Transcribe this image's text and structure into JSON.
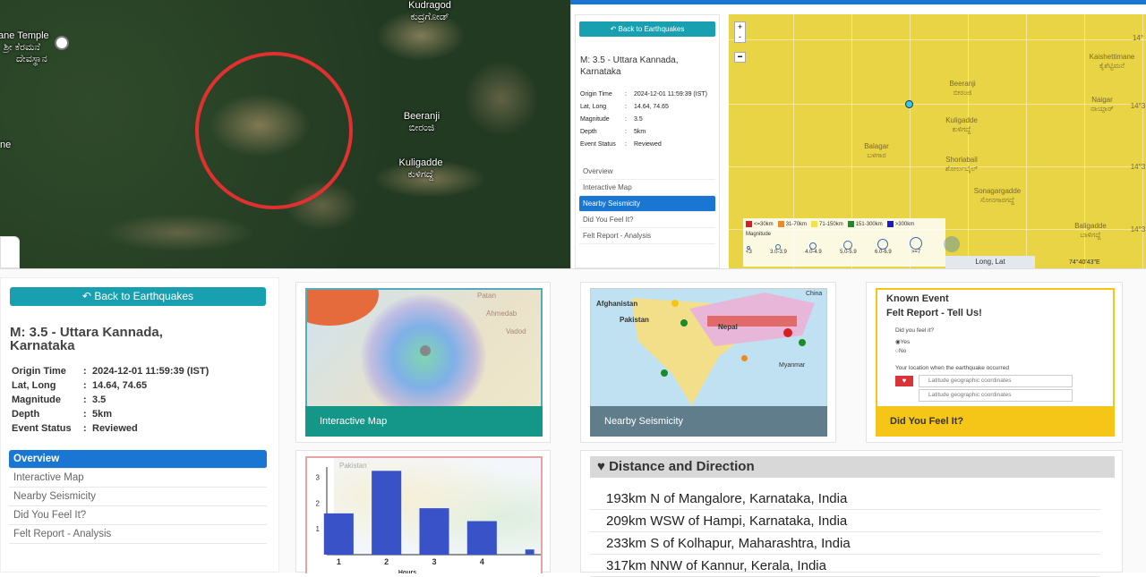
{
  "satellite": {
    "labels": [
      "Kudragod",
      "ಕುದ್ರಗೋಡ್",
      "ane Temple",
      "ಶ್ರೀ ಕೆರಮನೆ",
      "ದೇವಸ್ಥಾನ",
      "Beeranji",
      "ಬೀರಂಜಿ",
      "Kuligadde",
      "ಕುಳಿಗದ್ದೆ",
      "ne"
    ]
  },
  "small_panel": {
    "back_label": "Back to Earthquakes",
    "title": "M: 3.5 - Uttara Kannada, Karnataka",
    "info": [
      {
        "k": "Origin Time",
        "v": "2024-12-01 11:59:39 (IST)"
      },
      {
        "k": "Lat, Long",
        "v": "14.64, 74.65"
      },
      {
        "k": "Magnitude",
        "v": "3.5"
      },
      {
        "k": "Depth",
        "v": "5km"
      },
      {
        "k": "Event Status",
        "v": "Reviewed"
      }
    ],
    "nav": [
      "Overview",
      "Interactive Map",
      "Nearby Seismicity",
      "Did You Feel It?",
      "Felt Report - Analysis"
    ],
    "active_nav": 2
  },
  "yellow_map": {
    "zoom_in": "+",
    "zoom_out": "-",
    "towns": [
      {
        "en": "Beeranji",
        "kn": "ಬೀರಂಜಿ"
      },
      {
        "en": "Kuligadde",
        "kn": "ಕುಳಿಗದ್ದೆ"
      },
      {
        "en": "Shorlabail",
        "kn": "ಶೋರ್ಲಬೈಲ್"
      },
      {
        "en": "Balagar",
        "kn": "ಬಳಗಾರ"
      },
      {
        "en": "Sonagargadde",
        "kn": "ಸೋನಗಾರಗದ್ದೆ"
      },
      {
        "en": "Kaishettimane",
        "kn": "ಕೈಶೆಟ್ಟಿಮನೆ"
      },
      {
        "en": "Naigar",
        "kn": "ನಾಯ್ಗಾರ್"
      },
      {
        "en": "Baligadde",
        "kn": "ಬಾಳಿಗದ್ದೆ"
      }
    ],
    "lat_labels": [
      "14°",
      "14°3",
      "14°3",
      "14°3"
    ],
    "lonlat_label": "Long, Lat",
    "corner_coords": "74°40'43\"E",
    "legend": {
      "distances": [
        {
          "label": "<=30km",
          "color": "#d62020"
        },
        {
          "label": "31-70km",
          "color": "#f08a1c"
        },
        {
          "label": "71-150km",
          "color": "#f5e14a"
        },
        {
          "label": "151-300km",
          "color": "#1f8a2a"
        },
        {
          "label": ">300km",
          "color": "#1a1ac8"
        }
      ],
      "magnitude_title": "Magnitude",
      "magnitudes": [
        "<3",
        "3.0-3.9",
        "4.0-4.9",
        "5.0-5.9",
        "6.0-6.9",
        ">=7"
      ]
    }
  },
  "big_panel": {
    "back_label": "Back to Earthquakes",
    "title_line1": "M: 3.5 - Uttara Kannada,",
    "title_line2": "Karnataka",
    "info": [
      {
        "k": "Origin Time",
        "v": "2024-12-01 11:59:39 (IST)"
      },
      {
        "k": "Lat, Long",
        "v": "14.64, 74.65"
      },
      {
        "k": "Magnitude",
        "v": "3.5"
      },
      {
        "k": "Depth",
        "v": "5km"
      },
      {
        "k": "Event Status",
        "v": "Reviewed"
      }
    ],
    "nav": [
      "Overview",
      "Interactive Map",
      "Nearby Seismicity",
      "Did You Feel It?",
      "Felt Report - Analysis"
    ],
    "active_nav": 0
  },
  "cards": {
    "interactive_map": {
      "label": "Interactive Map",
      "color": "#149688",
      "places": [
        "Patan",
        "Ahmedab",
        "Vadod"
      ]
    },
    "nearby_seismicity": {
      "label": "Nearby Seismicity",
      "color": "#607d8b",
      "places": [
        "Afghanistan",
        "Pakistan",
        "Nepal",
        "Myanmar",
        "China"
      ]
    },
    "felt_report": {
      "heading1": "Known Event",
      "heading2": "Felt Report - Tell Us!",
      "question": "Did you feel it?",
      "option_yes": "Yes",
      "option_no": "No",
      "location_label": "Your location when the earthquake occurred",
      "placeholder": "Latitude geographic coordinates",
      "footer": "Did You Feel It?",
      "footer_color": "#f5c518"
    }
  },
  "chart_data": {
    "type": "bar",
    "categories": [
      "1",
      "2",
      "3",
      "4"
    ],
    "x": [
      0.75,
      1.75,
      2.75,
      3.75,
      4.75
    ],
    "values": [
      1.6,
      3.25,
      1.8,
      1.3,
      0.2
    ],
    "xticks": [
      "1",
      "2",
      "3",
      "4"
    ],
    "yticks": [
      "1",
      "2",
      "3"
    ],
    "ylim": [
      0,
      3.4
    ],
    "xlabel": "Hours",
    "ylabel": "",
    "bar_color": "#3a52c8",
    "map_text": [
      "Pakistan"
    ]
  },
  "distance": {
    "heading": "Distance and Direction",
    "items": [
      "193km N of Mangalore, Karnataka, India",
      "209km WSW of Hampi, Karnataka, India",
      "233km S of Kolhapur, Maharashtra, India",
      "317km NNW of Kannur, Kerala, India"
    ]
  }
}
